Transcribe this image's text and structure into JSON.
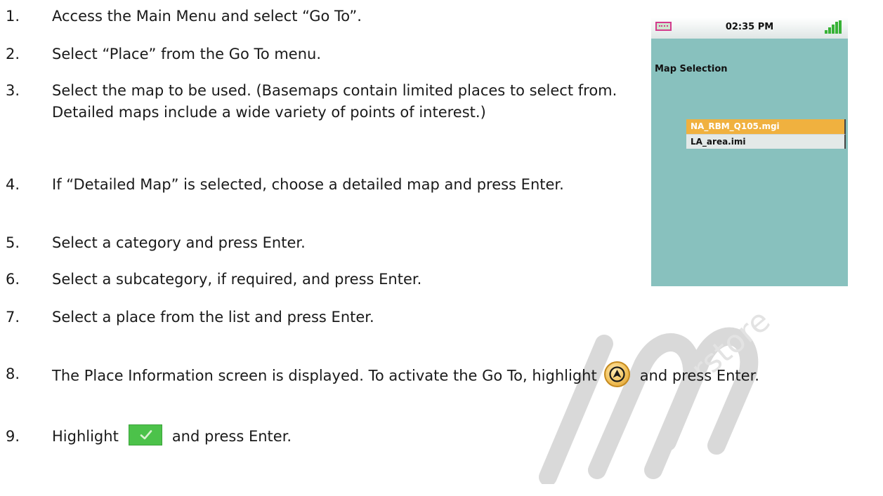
{
  "steps": [
    {
      "num": "1.",
      "text": "Access the Main Menu and select “Go To”."
    },
    {
      "num": "2.",
      "text": "Select “Place” from the Go To menu."
    },
    {
      "num": "3.",
      "text": "Select the map to be used.  (Basemaps contain limited places to select from. Detailed maps include a wide variety of points of interest.)"
    },
    {
      "num": "4.",
      "text": "If “Detailed Map” is selected, choose a detailed map and press Enter."
    },
    {
      "num": "5.",
      "text": "Select a category and press Enter."
    },
    {
      "num": "6.",
      "text": "Select a subcategory, if required, and press Enter."
    },
    {
      "num": "7.",
      "text": "Select a place from the list and press Enter."
    },
    {
      "num": "8.",
      "text_before": "The Place Information screen is displayed. To activate the Go To, highlight",
      "text_after": "and press Enter."
    },
    {
      "num": "9.",
      "text_before": "Highlight",
      "text_after": "and press Enter."
    }
  ],
  "icons": {
    "go_to": "go-to-arrow-icon",
    "confirm": "checkmark-icon"
  },
  "device": {
    "time": "02:35 PM",
    "screen_title": "Map Selection",
    "maps": [
      {
        "label": "NA_RBM_Q105.mgi",
        "selected": true
      },
      {
        "label": "LA_area.imi",
        "selected": false
      }
    ]
  },
  "colors": {
    "screen_bg": "#88c1be",
    "selected_item": "#f0b13f",
    "signal": "#37b236",
    "confirm_button": "#4cc24a"
  }
}
